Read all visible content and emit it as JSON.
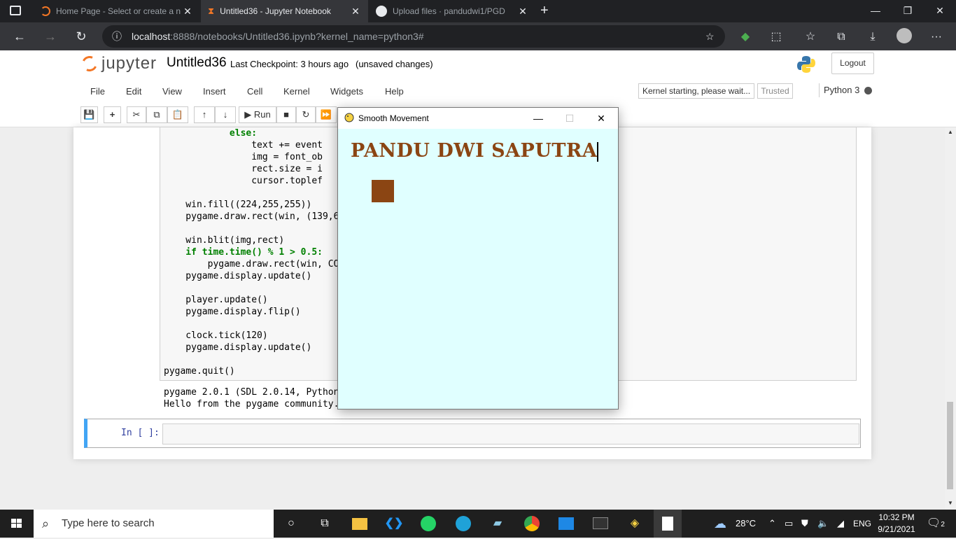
{
  "browser": {
    "tabs": [
      {
        "title": "Home Page - Select or create a n",
        "active": false
      },
      {
        "title": "Untitled36 - Jupyter Notebook",
        "active": true
      },
      {
        "title": "Upload files · pandudwi1/PGD",
        "active": false
      }
    ],
    "url_host": "localhost",
    "url_rest": ":8888/notebooks/Untitled36.ipynb?kernel_name=python3#"
  },
  "jupyter": {
    "logo_text": "jupyter",
    "notebook_title": "Untitled36",
    "checkpoint": "Last Checkpoint: 3 hours ago",
    "unsaved": "(unsaved changes)",
    "logout": "Logout",
    "menu": [
      "File",
      "Edit",
      "View",
      "Insert",
      "Cell",
      "Kernel",
      "Widgets",
      "Help"
    ],
    "kernel_status": "Kernel starting, please wait...",
    "trusted": "Trusted",
    "kernel_name": "Python 3",
    "run_label": "Run"
  },
  "code_lines": [
    "            else:",
    "                text += event",
    "                img = font_ob",
    "                rect.size = i",
    "                cursor.toplef",
    "",
    "    win.fill((224,255,255))",
    "    pygame.draw.rect(win, (139,69",
    "",
    "    win.blit(img,rect)",
    "    if time.time() % 1 > 0.5:",
    "        pygame.draw.rect(win, COL",
    "    pygame.display.update()",
    "",
    "    player.update()",
    "    pygame.display.flip()",
    "",
    "    clock.tick(120)",
    "    pygame.display.update()",
    "",
    "pygame.quit()"
  ],
  "output_lines": [
    "pygame 2.0.1 (SDL 2.0.14, Python",
    "Hello from the pygame community."
  ],
  "new_cell_prompt": "In [ ]:",
  "pygame_window": {
    "title": "Smooth Movement",
    "text": "PANDU DWI SAPUTRA",
    "bg_color": "#e0ffff",
    "rect_color": "#8b4513"
  },
  "taskbar": {
    "search_placeholder": "Type here to search",
    "weather": "28°C",
    "lang": "ENG",
    "time": "10:32 PM",
    "date": "9/21/2021",
    "notifications": "2"
  }
}
